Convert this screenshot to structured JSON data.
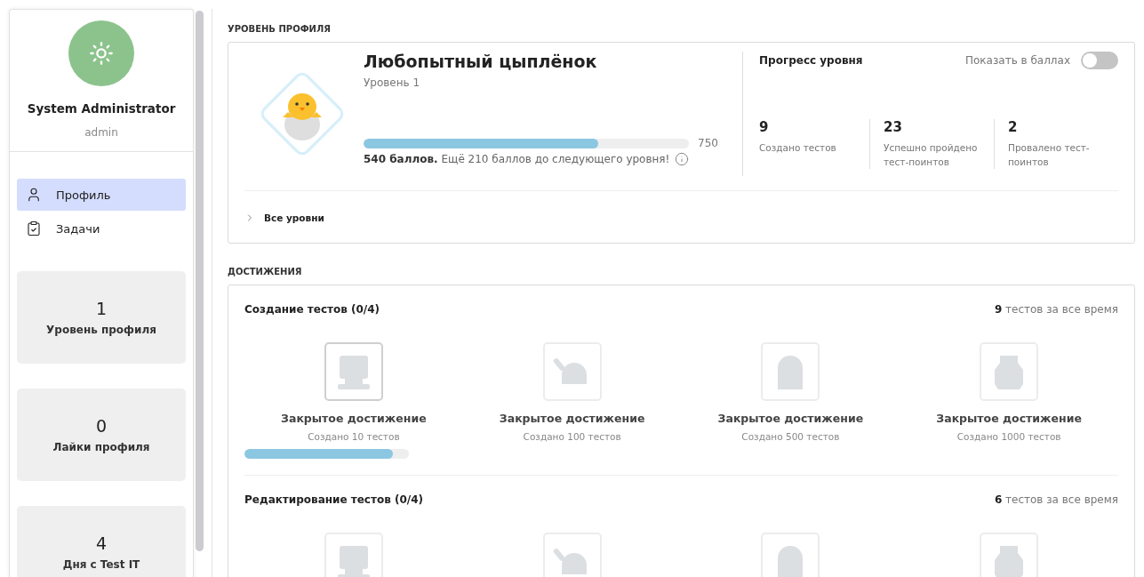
{
  "sidebar": {
    "user": {
      "name": "System Administrator",
      "login": "admin"
    },
    "nav": [
      {
        "label": "Профиль",
        "selected": true
      },
      {
        "label": "Задачи",
        "selected": false
      }
    ],
    "stats": [
      {
        "value": "1",
        "label": "Уровень профиля"
      },
      {
        "value": "0",
        "label": "Лайки профиля"
      },
      {
        "value": "4",
        "label": "Дня с Test IT"
      }
    ]
  },
  "profile_level": {
    "section_title": "УРОВЕНЬ ПРОФИЛЯ",
    "level_name": "Любопытный цыплёнок",
    "level_label": "Уровень 1",
    "level": 0.72,
    "max": "750",
    "points_text": "**540 баллов.** Ещё 210 баллов до следующего уровня!",
    "progress_title": "Прогресс уровня",
    "toggle": {
      "label": "Показать в баллах",
      "on": false
    },
    "metrics": [
      {
        "value": "9",
        "label": "Создано тестов"
      },
      {
        "value": "23",
        "label": "Успешно пройдено тест-поинтов"
      },
      {
        "value": "2",
        "label": "Провалено тест-поинтов"
      }
    ],
    "all_levels": {
      "label": "Все уровни",
      "expanded": false
    }
  },
  "achievements": {
    "section_title": "ДОСТИЖЕНИЯ",
    "groups": [
      {
        "title": "Создание тестов (0/4)",
        "total": "**9** тестов за все время",
        "items": [
          {
            "locked": true,
            "title": "Закрытое достижение",
            "subtitle": "Создано 10 тестов",
            "level": 0.9
          },
          {
            "locked": true,
            "title": "Закрытое достижение",
            "subtitle": "Создано 100 тестов"
          },
          {
            "locked": true,
            "title": "Закрытое достижение",
            "subtitle": "Создано 500 тестов"
          },
          {
            "locked": true,
            "title": "Закрытое достижение",
            "subtitle": "Создано 1000 тестов"
          }
        ]
      },
      {
        "title": "Редактирование тестов (0/4)",
        "total": "**6** тестов за все время",
        "items": [
          {
            "locked": true
          },
          {
            "locked": true
          },
          {
            "locked": true
          },
          {
            "locked": true
          }
        ]
      }
    ]
  }
}
